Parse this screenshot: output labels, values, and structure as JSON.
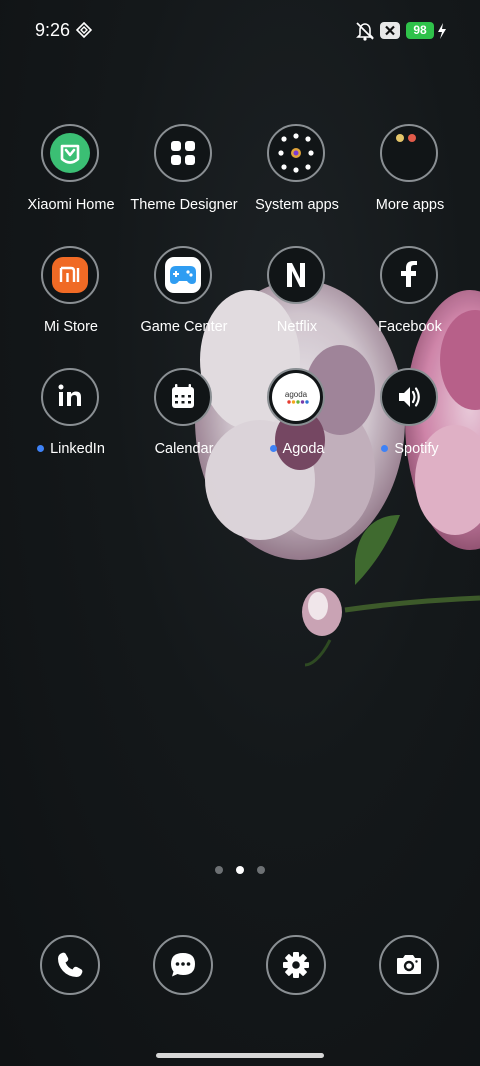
{
  "status_bar": {
    "time": "9:26",
    "battery": "98",
    "icons": [
      "vpn-diamond-icon",
      "mute-icon",
      "x-close-box-icon",
      "battery-icon",
      "charging-bolt-icon"
    ]
  },
  "apps": [
    {
      "label": "Xiaomi Home",
      "icon": "xiaomi-home-icon",
      "notification": false
    },
    {
      "label": "Theme Designer",
      "icon": "theme-designer-grid-icon",
      "notification": false
    },
    {
      "label": "System apps",
      "icon": "folder-system-apps-icon",
      "notification": false
    },
    {
      "label": "More apps",
      "icon": "folder-more-apps-icon",
      "notification": false
    },
    {
      "label": "Mi Store",
      "icon": "mi-store-icon",
      "notification": false
    },
    {
      "label": "Game Center",
      "icon": "game-center-controller-icon",
      "notification": false
    },
    {
      "label": "Netflix",
      "icon": "netflix-n-icon",
      "notification": false
    },
    {
      "label": "Facebook",
      "icon": "facebook-f-icon",
      "notification": false
    },
    {
      "label": "LinkedIn",
      "icon": "linkedin-icon",
      "notification": true
    },
    {
      "label": "Calendar",
      "icon": "calendar-icon",
      "notification": false
    },
    {
      "label": "Agoda",
      "icon": "agoda-icon",
      "notification": true
    },
    {
      "label": "Spotify",
      "icon": "spotify-speaker-icon",
      "notification": true
    }
  ],
  "agoda_logo_text": "agoda",
  "page_indicator": {
    "pages": 3,
    "current": 2
  },
  "dock": [
    {
      "icon": "phone-icon"
    },
    {
      "icon": "messages-icon"
    },
    {
      "icon": "settings-gear-icon"
    },
    {
      "icon": "camera-icon"
    }
  ],
  "colors": {
    "notification_dot": "#3e82f7",
    "battery_green": "#2fc24a",
    "xiaomi_home_green": "#3bbf74",
    "mi_store_orange": "#f06a25"
  }
}
